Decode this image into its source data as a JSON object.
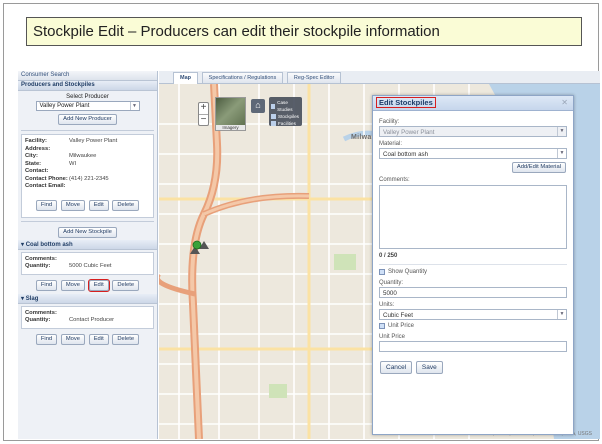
{
  "caption": "Stockpile Edit – Producers can edit their stockpile information",
  "sidebar": {
    "consumer_search": "Consumer Search",
    "producers_header": "Producers and Stockpiles",
    "select_label": "Select Producer",
    "selected_producer": "Valley Power Plant",
    "add_producer": "Add New Producer",
    "info": [
      {
        "key": "Facility:",
        "value": "Valley Power Plant"
      },
      {
        "key": "Address:",
        "value": ""
      },
      {
        "key": "City:",
        "value": "Milwaukee"
      },
      {
        "key": "State:",
        "value": "WI"
      },
      {
        "key": "Contact:",
        "value": ""
      },
      {
        "key": "Contact Phone:",
        "value": "(414) 221-2345"
      },
      {
        "key": "Contact Email:",
        "value": ""
      }
    ],
    "buttons": {
      "find": "Find",
      "move": "Move",
      "edit": "Edit",
      "delete": "Delete"
    },
    "add_stockpile": "Add New Stockpile",
    "stockpiles": [
      {
        "name": "Coal bottom ash",
        "comments": "",
        "quantity": "5000 Cubic Feet"
      },
      {
        "name": "Slag",
        "comments": "",
        "quantity": "Contact Producer"
      }
    ],
    "comments_label": "Comments:",
    "quantity_label": "Quantity:"
  },
  "tabs": [
    "Map",
    "Specifications / Regulations",
    "Reg-Spec Editor"
  ],
  "map": {
    "imagery_label": "Imagery",
    "layers": [
      "Case Studies",
      "Stockpiles",
      "Facilities"
    ],
    "city_label": "Milwaukee",
    "attribution": "Esri, HERE, DeLorme, increment P, NGA, USGS"
  },
  "dialog": {
    "title": "Edit Stockpiles",
    "facility_label": "Facility:",
    "facility_value": "Valley Power Plant",
    "material_label": "Material:",
    "material_value": "Coal bottom ash",
    "add_material": "Add/Edit Material",
    "comments_label": "Comments:",
    "counter": "0 / 250",
    "show_quantity": "Show Quantity",
    "quantity_label": "Quantity:",
    "quantity_value": "5000",
    "units_label": "Units:",
    "units_value": "Cubic Feet",
    "unit_price_check": "Unit Price",
    "unit_price_label": "Unit Price",
    "unit_price_value": "",
    "cancel": "Cancel",
    "save": "Save"
  },
  "colors": {
    "highlight": "#d61f1f",
    "caption_bg": "#fafcd6",
    "dialog_header": "#c6d6ec"
  }
}
